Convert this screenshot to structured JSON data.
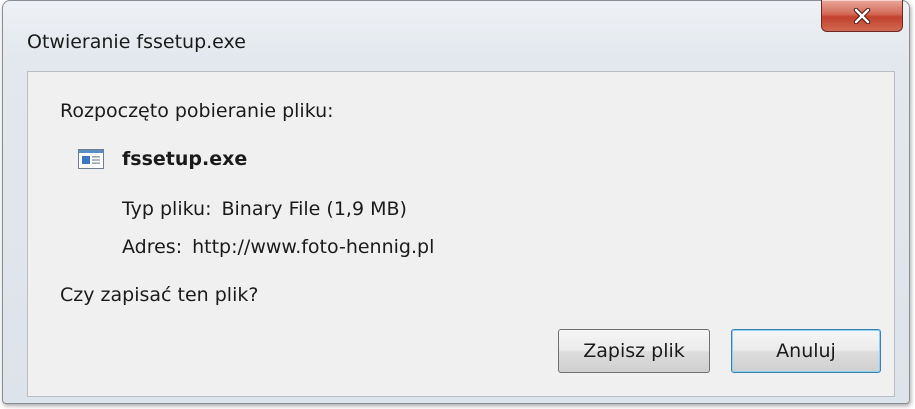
{
  "window": {
    "title": "Otwieranie fssetup.exe",
    "close_icon": "close-x-icon"
  },
  "dialog": {
    "heading": "Rozpoczęto pobieranie pliku:",
    "file_icon": "executable-file-icon",
    "file_name": "fssetup.exe",
    "type_label": "Typ pliku:",
    "type_value": "Binary File (1,9 MB)",
    "address_label": "Adres:",
    "address_value": "http://www.foto-hennig.pl",
    "question": "Czy zapisać ten plik?"
  },
  "buttons": {
    "save_label": "Zapisz plik",
    "cancel_label": "Anuluj"
  },
  "colors": {
    "close_button": "#c7432f",
    "default_button_border": "#3c7fb1"
  }
}
